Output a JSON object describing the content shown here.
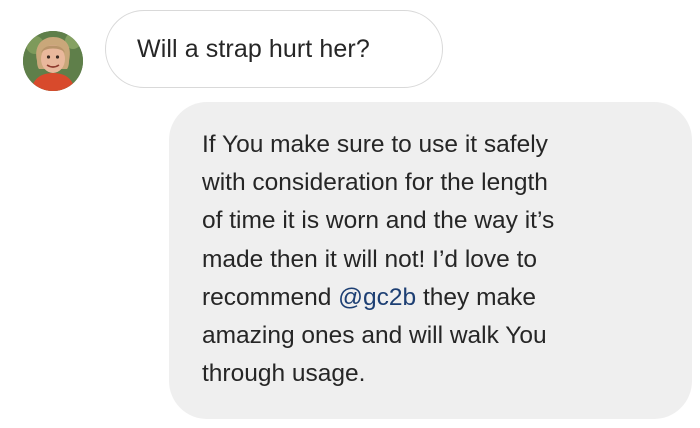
{
  "conversation": {
    "incoming": {
      "text": "Will a strap hurt her?"
    },
    "outgoing": {
      "lines": [
        "If You make sure to use it safely",
        "with consideration for the length",
        "of time it is worn and the way it’s",
        "made then it will not! I’d love to"
      ],
      "line5_before": "recommend ",
      "mention": "@gc2b",
      "line5_after": " they make",
      "lines_after": [
        "amazing ones and will walk You",
        "through usage."
      ]
    }
  },
  "colors": {
    "outgoing_bubble": "#efefef",
    "incoming_border": "#d9d9d9",
    "mention": "#1d3f73",
    "text": "#262626"
  }
}
